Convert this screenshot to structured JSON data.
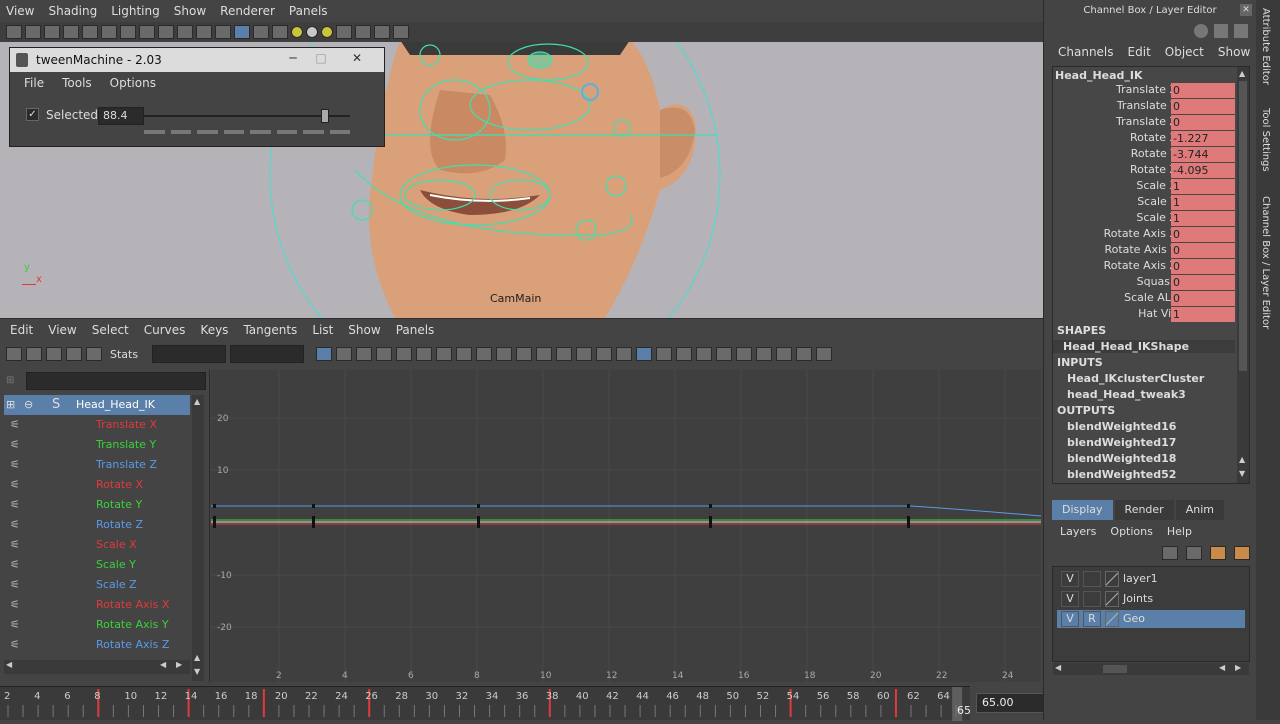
{
  "viewport": {
    "menu": [
      "View",
      "Shading",
      "Lighting",
      "Show",
      "Renderer",
      "Panels"
    ],
    "camera_label": "CamMain",
    "axis_y": "y",
    "axis_x": "x"
  },
  "tween": {
    "title": "tweenMachine - 2.03",
    "menu": [
      "File",
      "Tools",
      "Options"
    ],
    "selected_label": "Selected",
    "value": "88.4",
    "slider_fraction": 0.88
  },
  "graph_editor": {
    "menu": [
      "Edit",
      "View",
      "Select",
      "Curves",
      "Keys",
      "Tangents",
      "List",
      "Show",
      "Panels"
    ],
    "stats_label": "Stats",
    "outliner_root": "Head_Head_IK",
    "channels": [
      {
        "label": "Translate X",
        "color": "#e03a3a"
      },
      {
        "label": "Translate Y",
        "color": "#3ad13a"
      },
      {
        "label": "Translate Z",
        "color": "#5a9ae8"
      },
      {
        "label": "Rotate X",
        "color": "#e03a3a"
      },
      {
        "label": "Rotate Y",
        "color": "#3ad13a"
      },
      {
        "label": "Rotate Z",
        "color": "#5a9ae8"
      },
      {
        "label": "Scale X",
        "color": "#e03a3a"
      },
      {
        "label": "Scale Y",
        "color": "#3ad13a"
      },
      {
        "label": "Scale Z",
        "color": "#5a9ae8"
      },
      {
        "label": "Rotate Axis X",
        "color": "#e03a3a"
      },
      {
        "label": "Rotate Axis Y",
        "color": "#3ad13a"
      },
      {
        "label": "Rotate Axis Z",
        "color": "#5a9ae8"
      }
    ],
    "y_ticks": [
      "20",
      "10",
      "-10",
      "-20"
    ],
    "x_ticks": [
      "2",
      "4",
      "6",
      "8",
      "10",
      "12",
      "14",
      "16",
      "18",
      "20",
      "22",
      "24"
    ]
  },
  "timeline": {
    "ticks": [
      "2",
      "4",
      "6",
      "8",
      "10",
      "12",
      "14",
      "16",
      "18",
      "20",
      "22",
      "24",
      "26",
      "28",
      "30",
      "32",
      "34",
      "36",
      "38",
      "40",
      "42",
      "44",
      "46",
      "48",
      "50",
      "52",
      "54",
      "56",
      "58",
      "60",
      "62",
      "64"
    ],
    "current_frame_label": "65",
    "current_frame_value": "65.00",
    "keys": [
      8,
      14,
      19,
      26,
      38,
      54,
      61
    ]
  },
  "channel_box": {
    "title": "Channel Box / Layer Editor",
    "menu": [
      "Channels",
      "Edit",
      "Object",
      "Show"
    ],
    "node": "Head_Head_IK",
    "attributes": [
      {
        "name": "Translate X",
        "value": "0"
      },
      {
        "name": "Translate Y",
        "value": "0"
      },
      {
        "name": "Translate Z",
        "value": "0"
      },
      {
        "name": "Rotate X",
        "value": "-1.227"
      },
      {
        "name": "Rotate Y",
        "value": "-3.744"
      },
      {
        "name": "Rotate Z",
        "value": "-4.095"
      },
      {
        "name": "Scale X",
        "value": "1"
      },
      {
        "name": "Scale Y",
        "value": "1"
      },
      {
        "name": "Scale Z",
        "value": "1"
      },
      {
        "name": "Rotate Axis X",
        "value": "0"
      },
      {
        "name": "Rotate Axis Y",
        "value": "0"
      },
      {
        "name": "Rotate Axis Z",
        "value": "0"
      },
      {
        "name": "Squash",
        "value": "0"
      },
      {
        "name": "Scale ALL",
        "value": "0"
      },
      {
        "name": "Hat Viz",
        "value": "1"
      }
    ],
    "shapes_header": "SHAPES",
    "shapes": [
      "Head_Head_IKShape"
    ],
    "inputs_header": "INPUTS",
    "inputs": [
      "Head_IKclusterCluster",
      "head_Head_tweak3"
    ],
    "outputs_header": "OUTPUTS",
    "outputs": [
      "blendWeighted16",
      "blendWeighted17",
      "blendWeighted18",
      "blendWeighted52"
    ]
  },
  "layer_editor": {
    "tabs": [
      "Display",
      "Render",
      "Anim"
    ],
    "menu": [
      "Layers",
      "Options",
      "Help"
    ],
    "layers": [
      {
        "v": "V",
        "r": "",
        "name": "layer1",
        "selected": false
      },
      {
        "v": "V",
        "r": "",
        "name": "Joints",
        "selected": false
      },
      {
        "v": "V",
        "r": "R",
        "name": "Geo",
        "selected": true
      }
    ]
  },
  "side_tabs": [
    "Attribute Editor",
    "Tool Settings",
    "Channel Box / Layer Editor"
  ]
}
